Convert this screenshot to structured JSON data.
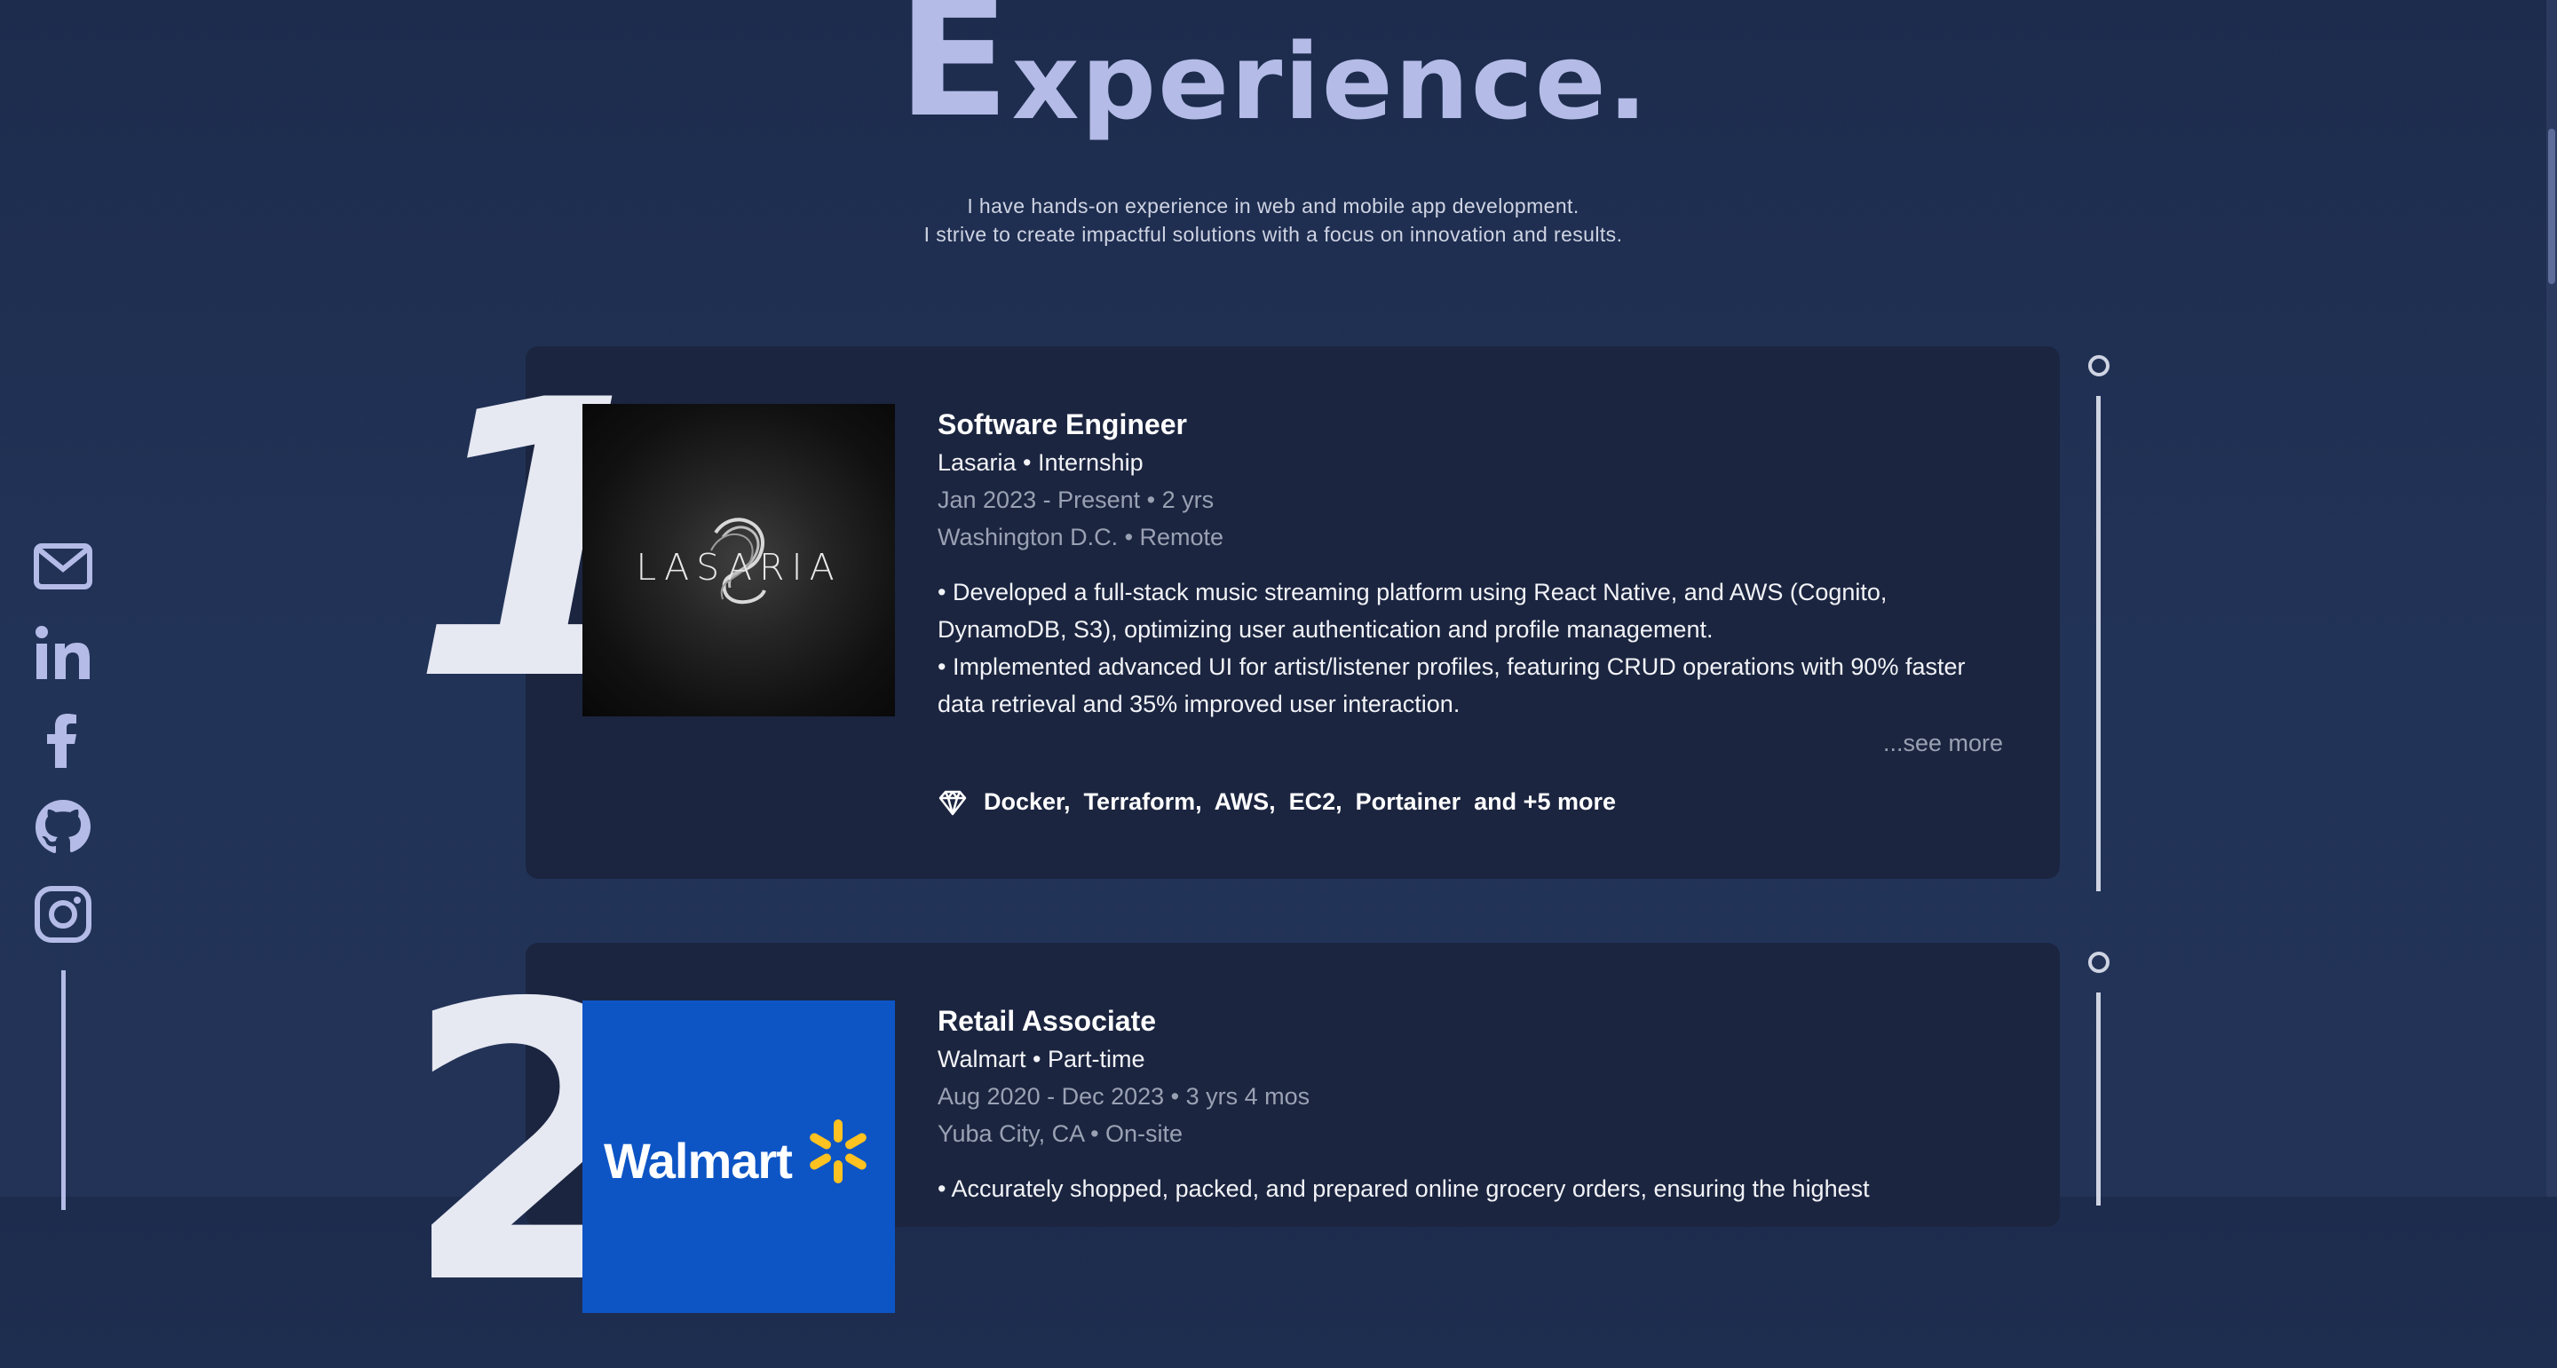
{
  "header": {
    "title_initial": "E",
    "title_rest": "xperience.",
    "subtitle_line1": "I have hands-on experience in web and mobile app development.",
    "subtitle_line2": "I strive to create impactful solutions with a focus on innovation and results."
  },
  "social": [
    {
      "name": "email-icon"
    },
    {
      "name": "linkedin-icon"
    },
    {
      "name": "facebook-icon"
    },
    {
      "name": "github-icon"
    },
    {
      "name": "instagram-icon"
    }
  ],
  "experiences": [
    {
      "number": "1",
      "logo_text": "LASARIA",
      "title": "Software Engineer",
      "company_line": "Lasaria • Internship",
      "dates": "Jan 2023 - Present • 2 yrs",
      "location": "Washington D.C. • Remote",
      "bullet1": "• Developed a full-stack music streaming platform using React Native, and AWS (Cognito, DynamoDB, S3), optimizing user authentication and profile management.",
      "bullet2": "• Implemented advanced UI for artist/listener profiles, featuring CRUD operations with 90% faster data retrieval and 35% improved user interaction.",
      "see_more": "...see more",
      "tech": "Docker,  Terraform,  AWS,  EC2,  Portainer  and +5 more"
    },
    {
      "number": "2",
      "logo_text": "Walmart",
      "title": "Retail Associate",
      "company_line": "Walmart • Part-time",
      "dates": "Aug 2020 - Dec 2023 • 3 yrs 4 mos",
      "location": "Yuba City, CA • On-site",
      "bullet1": "• Accurately shopped, packed, and prepared online grocery orders, ensuring the highest"
    }
  ],
  "colors": {
    "background": "#1d2c4d",
    "card": "#1b2540",
    "accent": "#b3bbe6",
    "walmart_blue": "#0d55c5",
    "walmart_spark": "#ffc220"
  }
}
